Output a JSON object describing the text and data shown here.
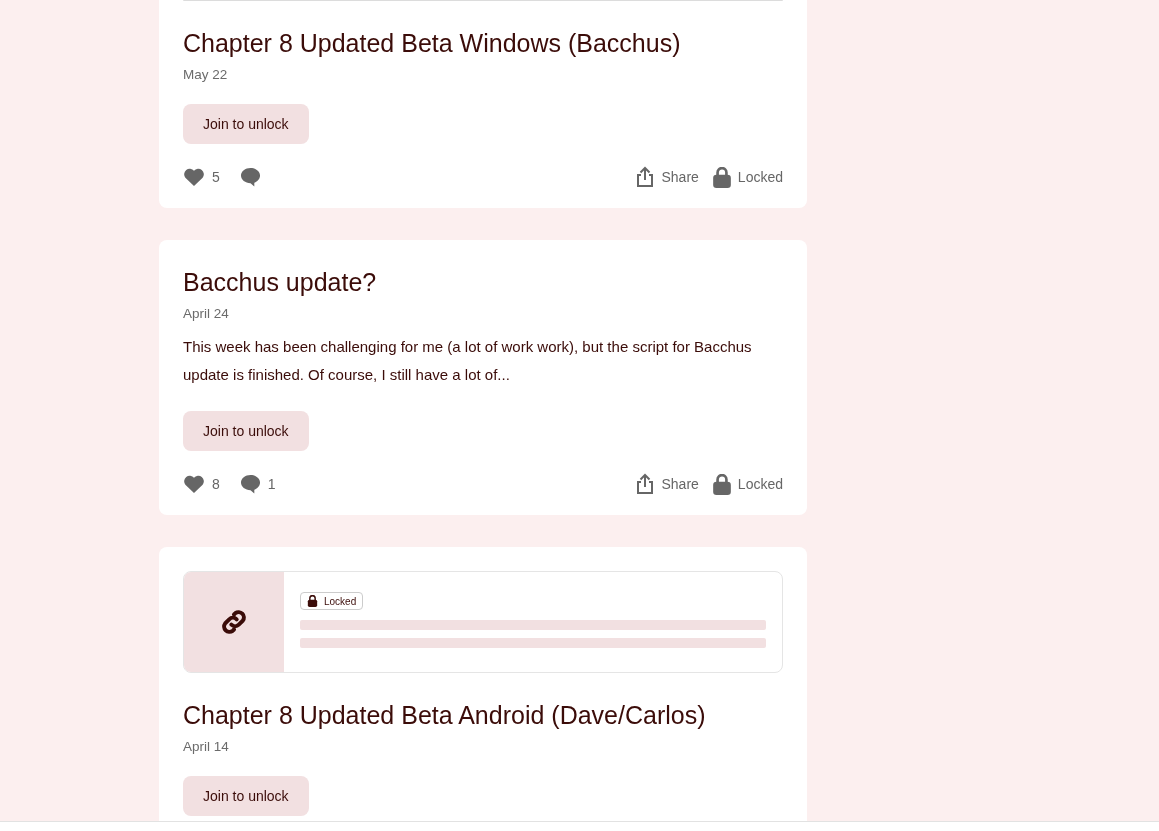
{
  "posts": [
    {
      "kind": "text",
      "title": "Chapter 8 Updated Beta Windows (Bacchus)",
      "date": "May 22",
      "button": "Join to unlock",
      "likes": "5",
      "share": "Share",
      "status": "Locked"
    },
    {
      "kind": "text",
      "title": "Bacchus update?",
      "date": "April 24",
      "excerpt": "This week has been challenging for me (a lot of work work), but the script for Bacchus update is finished. Of course, I still have a lot of...",
      "button": "Join to unlock",
      "likes": "8",
      "comments": "1",
      "share": "Share",
      "status": "Locked"
    },
    {
      "kind": "link",
      "preview_badge": "Locked",
      "title": "Chapter 8 Updated Beta Android (Dave/Carlos)",
      "date": "April 14",
      "button": "Join to unlock"
    }
  ]
}
